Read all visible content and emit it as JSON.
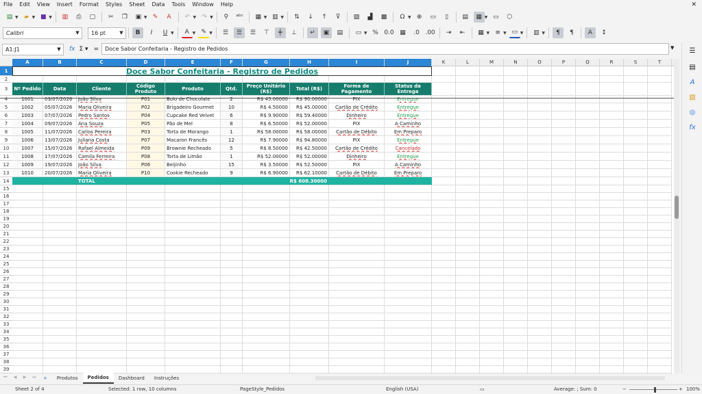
{
  "menu": [
    "File",
    "Edit",
    "View",
    "Insert",
    "Format",
    "Styles",
    "Sheet",
    "Data",
    "Tools",
    "Window",
    "Help"
  ],
  "toolbar": {
    "font_name": "Calibri",
    "font_size": "16 pt"
  },
  "formula_bar": {
    "name_box": "A1:J1",
    "content": "Doce Sabor Confeitaria - Registro de Pedidos"
  },
  "columns": [
    "A",
    "B",
    "C",
    "D",
    "E",
    "F",
    "G",
    "H",
    "I",
    "J",
    "K",
    "L",
    "M",
    "N",
    "O",
    "P",
    "Q",
    "R",
    "S",
    "T"
  ],
  "sheet": {
    "title": "Doce Sabor Confeitaria - Registro de Pedidos",
    "headers": [
      "Nº Pedido",
      "Data",
      "Cliente",
      "Código Produto",
      "Produto",
      "Qtd.",
      "Preço Unitário (R$)",
      "Total (R$)",
      "Forma de Pagamento",
      "Status da Entrega"
    ],
    "rows": [
      [
        "1001",
        "03/07/2026",
        "João Silva",
        "P01",
        "Bolo de Chocolate",
        "2",
        "R$ 45.00000",
        "R$ 90.00000",
        "PIX",
        "Entregue"
      ],
      [
        "1002",
        "05/07/2026",
        "Maria Oliveira",
        "P02",
        "Brigadeiro Gourmet",
        "10",
        "R$ 4.50000",
        "R$ 45.00000",
        "Cartão de Crédito",
        "Entregue"
      ],
      [
        "1003",
        "07/07/2026",
        "Pedro Santos",
        "P04",
        "Cupcake Red Velvet",
        "6",
        "R$ 9.90000",
        "R$ 59.40000",
        "Dinheiro",
        "Entregue"
      ],
      [
        "1004",
        "09/07/2026",
        "Ana Souza",
        "P05",
        "Pão de Mel",
        "8",
        "R$ 6.50000",
        "R$ 52.00000",
        "PIX",
        "A Caminho"
      ],
      [
        "1005",
        "11/07/2026",
        "Carlos Pereira",
        "P03",
        "Torta de Morango",
        "1",
        "R$ 58.00000",
        "R$ 58.00000",
        "Cartão de Débito",
        "Em Preparo"
      ],
      [
        "1006",
        "13/07/2026",
        "Juliana Costa",
        "P07",
        "Macaron Francês",
        "12",
        "R$ 7.90000",
        "R$ 94.80000",
        "PIX",
        "Entregue"
      ],
      [
        "1007",
        "15/07/2026",
        "Rafael Almeida",
        "P09",
        "Brownie Recheado",
        "5",
        "R$ 8.50000",
        "R$ 42.50000",
        "Cartão de Crédito",
        "Cancelado"
      ],
      [
        "1008",
        "17/07/2026",
        "Camila Ferreira",
        "P08",
        "Torta de Limão",
        "1",
        "R$ 52.00000",
        "R$ 52.00000",
        "Dinheiro",
        "Entregue"
      ],
      [
        "1009",
        "19/07/2026",
        "João Silva",
        "P06",
        "Beijinho",
        "15",
        "R$ 3.50000",
        "R$ 52.50000",
        "PIX",
        "A Caminho"
      ],
      [
        "1010",
        "20/07/2026",
        "Maria Oliveira",
        "P10",
        "Cookie Recheado",
        "9",
        "R$ 6.90000",
        "R$ 62.10000",
        "Cartão de Débito",
        "Em Preparo"
      ]
    ],
    "total_label": "TOTAL",
    "total_value": "R$ 608.30000"
  },
  "tabs": [
    "Produtos",
    "Pedidos",
    "Dashboard",
    "Instruções"
  ],
  "tab_plus": "+",
  "status": {
    "sheet": "Sheet 2 of 4",
    "selection": "Selected: 1 row, 10 columns",
    "page_style": "PageStyle_Pedidos",
    "language": "English (USA)",
    "summary": "Average: ; Sum: 0",
    "zoom": "100%"
  },
  "colors": {
    "header_bg": "#167d6d",
    "total_bg": "#1fb3a2",
    "title": "#0e8a7e",
    "selection": "#2b86d6"
  }
}
